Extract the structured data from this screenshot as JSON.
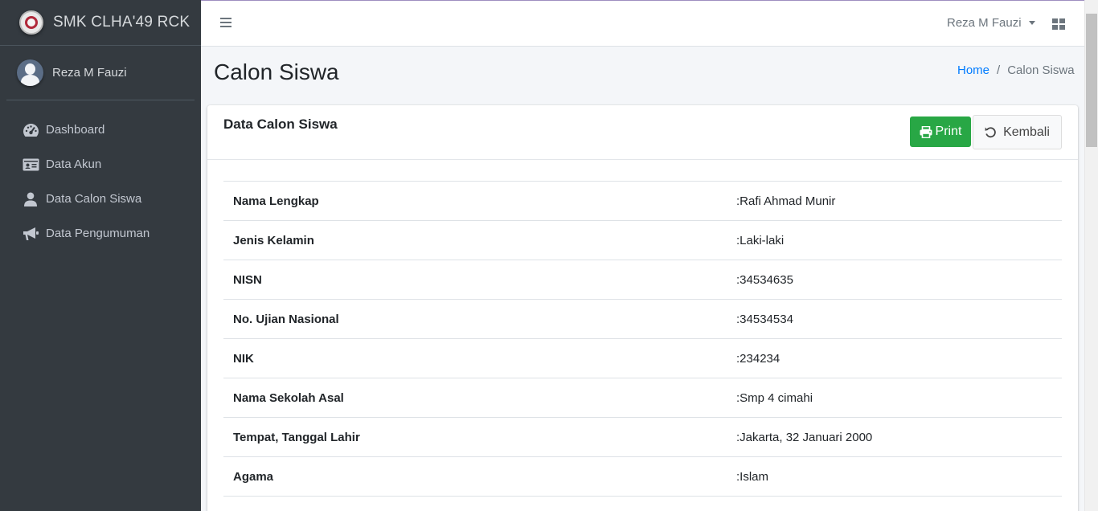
{
  "brand": {
    "name": "SMK CLHA'49 RCK"
  },
  "user_panel": {
    "name": "Reza M Fauzi"
  },
  "sidebar": {
    "items": [
      {
        "label": "Dashboard",
        "icon": "tachometer-icon"
      },
      {
        "label": "Data Akun",
        "icon": "id-card-icon"
      },
      {
        "label": "Data Calon Siswa",
        "icon": "user-icon"
      },
      {
        "label": "Data Pengumuman",
        "icon": "bullhorn-icon"
      }
    ]
  },
  "topbar": {
    "user_menu_label": "Reza M Fauzi"
  },
  "header": {
    "title": "Calon Siswa",
    "breadcrumb": {
      "home": "Home",
      "separator": "/",
      "current": "Calon Siswa"
    }
  },
  "card": {
    "title": "Data Calon Siswa",
    "print_label": "Print",
    "back_label": "Kembali"
  },
  "details": [
    {
      "label": "Nama Lengkap",
      "value": ":Rafi Ahmad Munir"
    },
    {
      "label": "Jenis Kelamin",
      "value": ":Laki-laki"
    },
    {
      "label": "NISN",
      "value": ":34534635"
    },
    {
      "label": "No. Ujian Nasional",
      "value": ":34534534"
    },
    {
      "label": "NIK",
      "value": ":234234"
    },
    {
      "label": "Nama Sekolah Asal",
      "value": ":Smp 4 cimahi"
    },
    {
      "label": "Tempat, Tanggal Lahir",
      "value": ":Jakarta, 32 Januari 2000"
    },
    {
      "label": "Agama",
      "value": ":Islam"
    }
  ],
  "colors": {
    "sidebar_bg": "#343a40",
    "print_button": "#28a745",
    "link": "#007bff",
    "content_bg": "#f4f6f9"
  }
}
